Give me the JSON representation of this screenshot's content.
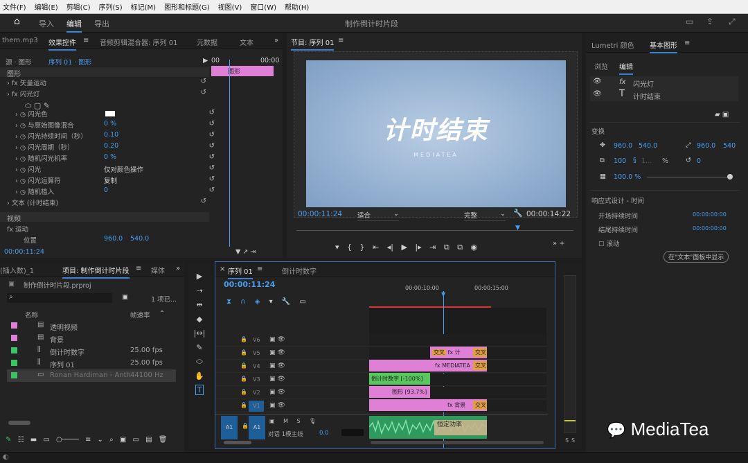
{
  "menu": [
    "文件(F)",
    "编辑(E)",
    "剪辑(C)",
    "序列(S)",
    "标记(M)",
    "图形和标题(G)",
    "视图(V)",
    "窗口(W)",
    "帮助(H)"
  ],
  "header": {
    "home": "⌂",
    "workspaces": [
      "导入",
      "编辑",
      "导出"
    ],
    "title": "制作倒计时片段"
  },
  "ec": {
    "tabs": [
      "them.mp3",
      "效果控件",
      "音频剪辑混合器: 序列 01",
      "元数据",
      "文本"
    ],
    "source": "源 · 图形",
    "seq": "序列 01 · 图形",
    "ruler_l": "00",
    "ruler_r": "00:00",
    "clip": "图形",
    "graphics_label": "图形",
    "rows": [
      {
        "t": "fx 矢量运动",
        "v": ""
      },
      {
        "t": "fx 闪光灯",
        "v": ""
      },
      {
        "t": "闪光色",
        "v": ""
      },
      {
        "t": "与原始图像混合",
        "v": "0 %"
      },
      {
        "t": "闪光持续时间（秒）",
        "v": "0.10"
      },
      {
        "t": "闪光周期（秒）",
        "v": "0.20"
      },
      {
        "t": "随机闪光机率",
        "v": "0 %"
      },
      {
        "t": "闪光",
        "v": "仅对颜色操作"
      },
      {
        "t": "闪光运算符",
        "v": "复制"
      },
      {
        "t": "随机植入",
        "v": "0"
      },
      {
        "t": "文本 (计时结束)",
        "v": ""
      }
    ],
    "video_label": "视频",
    "motion": "fx 运动",
    "pos_label": "位置",
    "pos_x": "960.0",
    "pos_y": "540.0",
    "timecode": "00:00:11:24"
  },
  "program": {
    "tab": "节目: 序列 01",
    "main_text": "计时结束",
    "sub_text": "MEDIATEA",
    "timecode": "00:00:11:24",
    "fit": "适合",
    "quality": "完整",
    "duration": "00:00:14:22"
  },
  "eg": {
    "tabs": [
      "Lumetri 颜色",
      "基本图形"
    ],
    "subtabs": [
      "浏览",
      "编辑"
    ],
    "layers": [
      "闪光灯",
      "计时结束"
    ],
    "transform": "变换",
    "px": "960.0",
    "py": "540.0",
    "sx": "960.0",
    "sy": "540",
    "scale": "100",
    "scale2": "1...",
    "pct": "%",
    "rot": "0",
    "opacity": "100.0 %",
    "resp": "响应式设计 - 时间",
    "start": "开场持续时间",
    "start_v": "00:00:00:00",
    "end": "结尾持续时间",
    "end_v": "00:00:00:00",
    "roll": "滚动",
    "link": "在\"文本\"面板中显示"
  },
  "project": {
    "tabs": [
      "(插入数)_1",
      "项目: 制作倒计时片段",
      "媒体"
    ],
    "file": "制作倒计时片段.prproj",
    "count": "1 项已...",
    "col_name": "名称",
    "col_rate": "帧速率",
    "items": [
      {
        "name": "透明视频",
        "rate": "",
        "color": "#e07fd6"
      },
      {
        "name": "背景",
        "rate": "",
        "color": "#e07fd6"
      },
      {
        "name": "倒计时数字",
        "rate": "25.00 fps",
        "color": "#3cc462"
      },
      {
        "name": "序列 01",
        "rate": "25.00 fps",
        "color": "#3cc462"
      },
      {
        "name": "Ronan Hardiman - Anth",
        "rate": "44100 Hz",
        "color": "#3cc462"
      }
    ]
  },
  "timeline": {
    "tabs": [
      "序列 01",
      "倒计时数字"
    ],
    "timecode": "00:00:11:24",
    "t1": "00:00:10:00",
    "t2": "00:00:15:00",
    "tracks": [
      "V6",
      "V5",
      "V4",
      "V3",
      "V2",
      "V1"
    ],
    "audio": "A1",
    "mix": "对话 1模主线",
    "mixv": "0.0",
    "clips": {
      "v5a": "交叉",
      "v5b": "计",
      "v5c": "交叉",
      "v4": "MEDIATEA",
      "v4c": "交叉",
      "v3": "倒计时数字 [-100%]",
      "v2": "图形 [93.7%]",
      "v1": "背景",
      "v1c": "交叉",
      "a1": "恒定功率"
    }
  },
  "meter": {
    "l": "S",
    "r": "S"
  },
  "watermark": "MediaTea",
  "colors": {
    "accent": "#4a9ef0",
    "pink": "#e07fd6",
    "green": "#3cc462",
    "orange": "#e0a040"
  }
}
